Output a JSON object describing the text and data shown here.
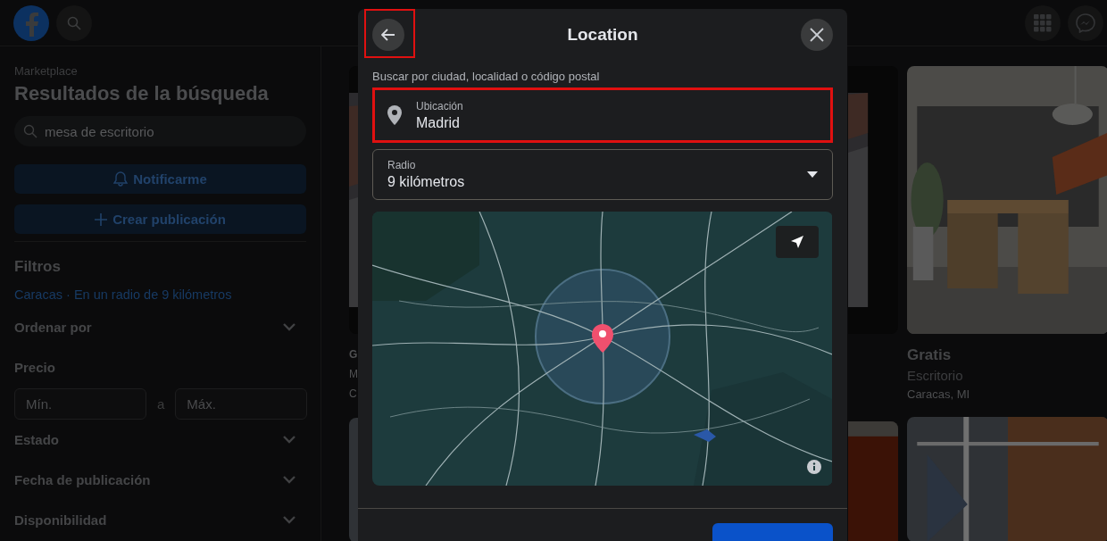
{
  "sidebar": {
    "breadcrumb": "Marketplace",
    "title": "Resultados de la búsqueda",
    "search": {
      "value": "mesa de escritorio"
    },
    "buttons": [
      {
        "kind": "notify",
        "label": "Notificarme"
      },
      {
        "kind": "create",
        "label": "Crear publicación"
      }
    ],
    "filters_title": "Filtros",
    "location_link": "Caracas · En un radio de 9 kilómetros",
    "filters": [
      {
        "kind": "dropdown",
        "label": "Ordenar por"
      },
      {
        "kind": "range",
        "label": "Precio",
        "min_placeholder": "Mín.",
        "separator": "a",
        "max_placeholder": "Máx."
      },
      {
        "kind": "dropdown",
        "label": "Estado"
      },
      {
        "kind": "dropdown",
        "label": "Fecha de publicación"
      },
      {
        "kind": "dropdown",
        "label": "Disponibilidad"
      }
    ]
  },
  "listings": [
    {
      "price": "G",
      "title": "M",
      "location": "C"
    },
    {
      "price": "Gratis",
      "title": "Escritorio",
      "location": "Caracas, MI"
    }
  ],
  "modal": {
    "title": "Location",
    "back_highlighted": true,
    "hint": "Buscar por ciudad, localidad o código postal",
    "location_field": {
      "label": "Ubicación",
      "value": "Madrid",
      "highlighted": true
    },
    "radius_field": {
      "label": "Radio",
      "value": "9 kilómetros"
    }
  }
}
